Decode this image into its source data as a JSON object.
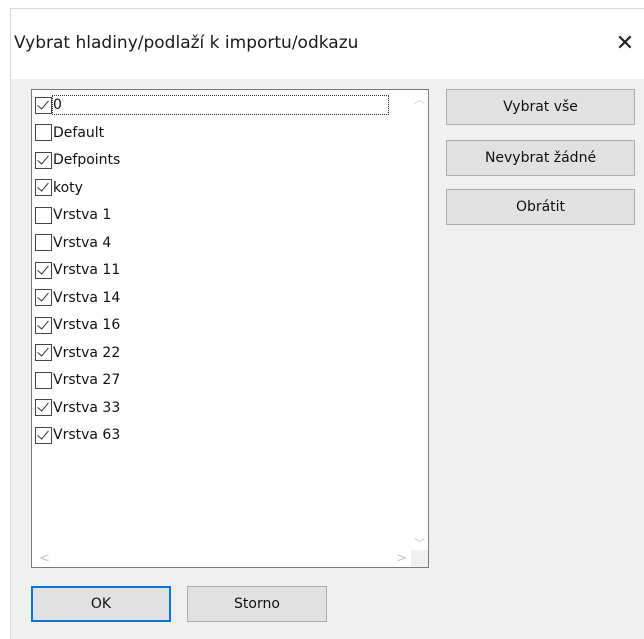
{
  "dialog": {
    "title": "Vybrat hladiny/podlaží k importu/odkazu",
    "close_glyph": "✕"
  },
  "layers": [
    {
      "label": "0",
      "checked": true
    },
    {
      "label": "Default",
      "checked": false
    },
    {
      "label": "Defpoints",
      "checked": true
    },
    {
      "label": "koty",
      "checked": true
    },
    {
      "label": "Vrstva 1",
      "checked": false
    },
    {
      "label": "Vrstva 4",
      "checked": false
    },
    {
      "label": "Vrstva 11",
      "checked": true
    },
    {
      "label": "Vrstva 14",
      "checked": true
    },
    {
      "label": "Vrstva 16",
      "checked": true
    },
    {
      "label": "Vrstva 22",
      "checked": true
    },
    {
      "label": "Vrstva 27",
      "checked": false
    },
    {
      "label": "Vrstva 33",
      "checked": true
    },
    {
      "label": "Vrstva 63",
      "checked": true
    }
  ],
  "buttons": {
    "select_all": "Vybrat vše",
    "select_none": "Nevybrat žádné",
    "invert": "Obrátit",
    "ok": "OK",
    "cancel": "Storno"
  },
  "icons": {
    "close": "close-icon",
    "checkbox": "checkmark-icon",
    "scroll_up": "chevron-up-icon",
    "scroll_down": "chevron-down-icon",
    "scroll_left": "chevron-left-icon",
    "scroll_right": "chevron-right-icon"
  },
  "colors": {
    "dialog_bg": "#f0f0f0",
    "button_bg": "#e1e1e1",
    "default_button_border": "#0078d7"
  }
}
